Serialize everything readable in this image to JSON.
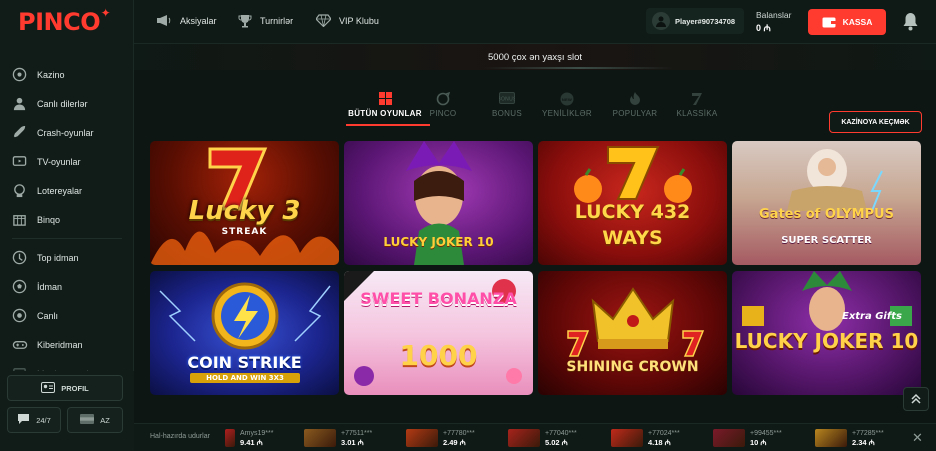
{
  "brand": {
    "logo_text": "PINCO",
    "accent": "#ff3b30"
  },
  "header": {
    "links": [
      {
        "label": "Aksiyalar",
        "icon": "megaphone-icon"
      },
      {
        "label": "Turnirlər",
        "icon": "trophy-icon"
      },
      {
        "label": "VIP Klubu",
        "icon": "diamond-icon"
      }
    ],
    "player_label": "Player#90734708",
    "balance_label": "Balanslar",
    "balance_value": "0 ₼",
    "kassa_label": "KASSA"
  },
  "sidebar": {
    "items": [
      {
        "label": "Kazino",
        "icon": "casino-icon"
      },
      {
        "label": "Canlı dilerlər",
        "icon": "live-dealer-icon"
      },
      {
        "label": "Crash-oyunlar",
        "icon": "rocket-icon"
      },
      {
        "label": "TV-oyunlar",
        "icon": "tv-icon"
      },
      {
        "label": "Lotereyalar",
        "icon": "lottery-icon"
      },
      {
        "label": "Binqo",
        "icon": "bingo-icon"
      },
      {
        "label": "Top idman",
        "icon": "top-sport-icon"
      },
      {
        "label": "İdman",
        "icon": "football-icon"
      },
      {
        "label": "Canlı",
        "icon": "live-icon"
      },
      {
        "label": "Kiberidman",
        "icon": "gamepad-icon"
      },
      {
        "label": "Məniın marclarım",
        "icon": "my-matches-icon"
      }
    ],
    "profile_label": "PROFIL",
    "support_label": "24/7",
    "lang_label": "AZ"
  },
  "banner": {
    "text": "5000 çox ən yaxşı slot"
  },
  "categories": {
    "active_index": 0,
    "items": [
      {
        "label": "BÜTÜN OYUNLAR",
        "icon": "grid-icon"
      },
      {
        "label": "PINCO",
        "icon": "pinco-icon"
      },
      {
        "label": "BONUS",
        "icon": "bonus-icon"
      },
      {
        "label": "YENİLİKLƏR",
        "icon": "new-icon"
      },
      {
        "label": "POPULYAR",
        "icon": "fire-icon"
      },
      {
        "label": "KLASSİKA",
        "icon": "seven-icon"
      }
    ],
    "casino_button": "KAZİNOYA KEÇMƏK"
  },
  "games": [
    {
      "title": "Lucky 3 Streak",
      "line1": "Lucky 3",
      "line2": "STREAK"
    },
    {
      "title": "Lucky Joker 10",
      "line1": "LUCKY JOKER 10",
      "line2": ""
    },
    {
      "title": "Lucky 432 Ways",
      "line1": "LUCKY 432",
      "line2": "WAYS"
    },
    {
      "title": "Gates of Olympus Super Scatter",
      "line1": "Gates of OLYMPUS",
      "line2": "SUPER SCATTER"
    },
    {
      "title": "Coin Strike Hold and Win 3x3",
      "line1": "COIN STRIKE",
      "line2": "HOLD AND WIN 3X3"
    },
    {
      "title": "Sweet Bonanza 1000",
      "line1": "SWEET BONANZA",
      "line2": "1000"
    },
    {
      "title": "Shining Crown",
      "line1": "SHINING CROWN",
      "line2": ""
    },
    {
      "title": "Lucky Joker 10 Extra Gifts",
      "line1": "LUCKY JOKER 10",
      "line2": "Extra Gifts"
    }
  ],
  "winners": {
    "label": "Hal-hazırda udurlar",
    "items": [
      {
        "user": "Amys19***",
        "amount": "9.41 ₼",
        "color": "#b01f1f"
      },
      {
        "user": "+77511***",
        "amount": "3.01 ₼",
        "color": "#8a5a1f"
      },
      {
        "user": "+77780***",
        "amount": "2.49 ₼",
        "color": "#b43a14"
      },
      {
        "user": "+77040***",
        "amount": "5.02 ₼",
        "color": "#a8231c"
      },
      {
        "user": "+77024***",
        "amount": "4.18 ₼",
        "color": "#c02a1a"
      },
      {
        "user": "+99455***",
        "amount": "10 ₼",
        "color": "#7a1a2a"
      },
      {
        "user": "+77285***",
        "amount": "2.34 ₼",
        "color": "#b8861f"
      }
    ]
  }
}
